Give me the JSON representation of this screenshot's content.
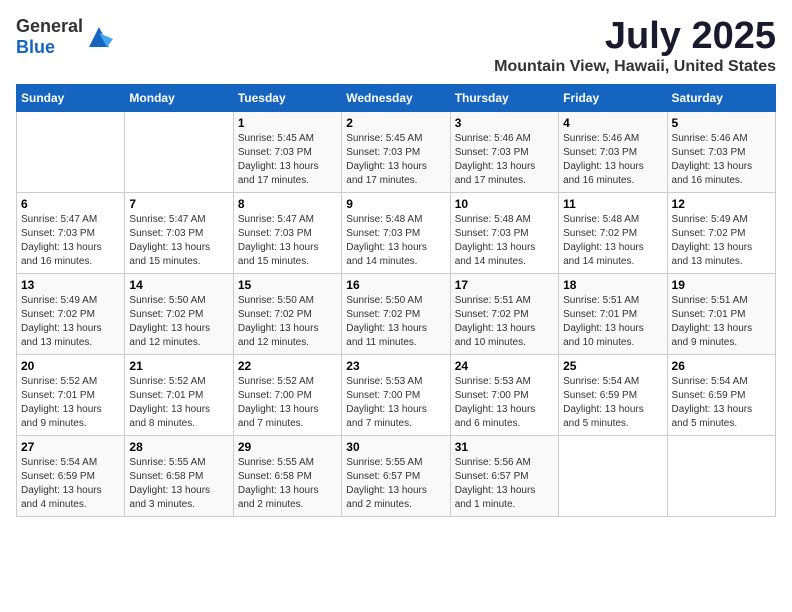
{
  "header": {
    "logo_general": "General",
    "logo_blue": "Blue",
    "month_title": "July 2025",
    "location": "Mountain View, Hawaii, United States"
  },
  "calendar": {
    "days_of_week": [
      "Sunday",
      "Monday",
      "Tuesday",
      "Wednesday",
      "Thursday",
      "Friday",
      "Saturday"
    ],
    "weeks": [
      [
        {
          "day": "",
          "info": ""
        },
        {
          "day": "",
          "info": ""
        },
        {
          "day": "1",
          "info": "Sunrise: 5:45 AM\nSunset: 7:03 PM\nDaylight: 13 hours\nand 17 minutes."
        },
        {
          "day": "2",
          "info": "Sunrise: 5:45 AM\nSunset: 7:03 PM\nDaylight: 13 hours\nand 17 minutes."
        },
        {
          "day": "3",
          "info": "Sunrise: 5:46 AM\nSunset: 7:03 PM\nDaylight: 13 hours\nand 17 minutes."
        },
        {
          "day": "4",
          "info": "Sunrise: 5:46 AM\nSunset: 7:03 PM\nDaylight: 13 hours\nand 16 minutes."
        },
        {
          "day": "5",
          "info": "Sunrise: 5:46 AM\nSunset: 7:03 PM\nDaylight: 13 hours\nand 16 minutes."
        }
      ],
      [
        {
          "day": "6",
          "info": "Sunrise: 5:47 AM\nSunset: 7:03 PM\nDaylight: 13 hours\nand 16 minutes."
        },
        {
          "day": "7",
          "info": "Sunrise: 5:47 AM\nSunset: 7:03 PM\nDaylight: 13 hours\nand 15 minutes."
        },
        {
          "day": "8",
          "info": "Sunrise: 5:47 AM\nSunset: 7:03 PM\nDaylight: 13 hours\nand 15 minutes."
        },
        {
          "day": "9",
          "info": "Sunrise: 5:48 AM\nSunset: 7:03 PM\nDaylight: 13 hours\nand 14 minutes."
        },
        {
          "day": "10",
          "info": "Sunrise: 5:48 AM\nSunset: 7:03 PM\nDaylight: 13 hours\nand 14 minutes."
        },
        {
          "day": "11",
          "info": "Sunrise: 5:48 AM\nSunset: 7:02 PM\nDaylight: 13 hours\nand 14 minutes."
        },
        {
          "day": "12",
          "info": "Sunrise: 5:49 AM\nSunset: 7:02 PM\nDaylight: 13 hours\nand 13 minutes."
        }
      ],
      [
        {
          "day": "13",
          "info": "Sunrise: 5:49 AM\nSunset: 7:02 PM\nDaylight: 13 hours\nand 13 minutes."
        },
        {
          "day": "14",
          "info": "Sunrise: 5:50 AM\nSunset: 7:02 PM\nDaylight: 13 hours\nand 12 minutes."
        },
        {
          "day": "15",
          "info": "Sunrise: 5:50 AM\nSunset: 7:02 PM\nDaylight: 13 hours\nand 12 minutes."
        },
        {
          "day": "16",
          "info": "Sunrise: 5:50 AM\nSunset: 7:02 PM\nDaylight: 13 hours\nand 11 minutes."
        },
        {
          "day": "17",
          "info": "Sunrise: 5:51 AM\nSunset: 7:02 PM\nDaylight: 13 hours\nand 10 minutes."
        },
        {
          "day": "18",
          "info": "Sunrise: 5:51 AM\nSunset: 7:01 PM\nDaylight: 13 hours\nand 10 minutes."
        },
        {
          "day": "19",
          "info": "Sunrise: 5:51 AM\nSunset: 7:01 PM\nDaylight: 13 hours\nand 9 minutes."
        }
      ],
      [
        {
          "day": "20",
          "info": "Sunrise: 5:52 AM\nSunset: 7:01 PM\nDaylight: 13 hours\nand 9 minutes."
        },
        {
          "day": "21",
          "info": "Sunrise: 5:52 AM\nSunset: 7:01 PM\nDaylight: 13 hours\nand 8 minutes."
        },
        {
          "day": "22",
          "info": "Sunrise: 5:52 AM\nSunset: 7:00 PM\nDaylight: 13 hours\nand 7 minutes."
        },
        {
          "day": "23",
          "info": "Sunrise: 5:53 AM\nSunset: 7:00 PM\nDaylight: 13 hours\nand 7 minutes."
        },
        {
          "day": "24",
          "info": "Sunrise: 5:53 AM\nSunset: 7:00 PM\nDaylight: 13 hours\nand 6 minutes."
        },
        {
          "day": "25",
          "info": "Sunrise: 5:54 AM\nSunset: 6:59 PM\nDaylight: 13 hours\nand 5 minutes."
        },
        {
          "day": "26",
          "info": "Sunrise: 5:54 AM\nSunset: 6:59 PM\nDaylight: 13 hours\nand 5 minutes."
        }
      ],
      [
        {
          "day": "27",
          "info": "Sunrise: 5:54 AM\nSunset: 6:59 PM\nDaylight: 13 hours\nand 4 minutes."
        },
        {
          "day": "28",
          "info": "Sunrise: 5:55 AM\nSunset: 6:58 PM\nDaylight: 13 hours\nand 3 minutes."
        },
        {
          "day": "29",
          "info": "Sunrise: 5:55 AM\nSunset: 6:58 PM\nDaylight: 13 hours\nand 2 minutes."
        },
        {
          "day": "30",
          "info": "Sunrise: 5:55 AM\nSunset: 6:57 PM\nDaylight: 13 hours\nand 2 minutes."
        },
        {
          "day": "31",
          "info": "Sunrise: 5:56 AM\nSunset: 6:57 PM\nDaylight: 13 hours\nand 1 minute."
        },
        {
          "day": "",
          "info": ""
        },
        {
          "day": "",
          "info": ""
        }
      ]
    ]
  }
}
